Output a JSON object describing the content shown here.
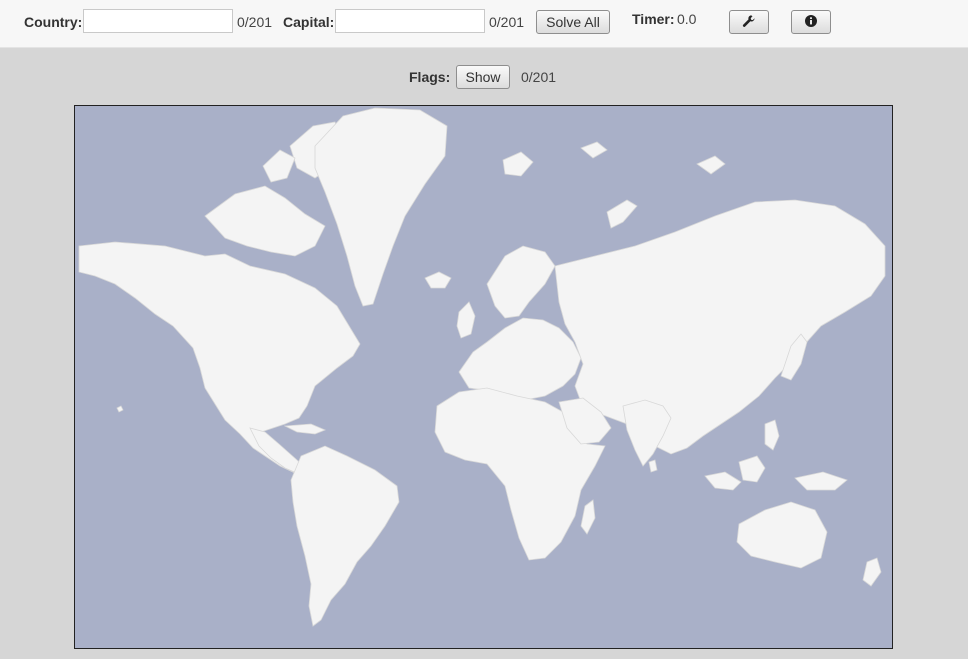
{
  "toolbar": {
    "country_label": "Country:",
    "country_value": "",
    "country_count": "0/201",
    "capital_label": "Capital:",
    "capital_value": "",
    "capital_count": "0/201",
    "solve_all_label": "Solve All",
    "timer_label": "Timer:",
    "timer_value": "0.0",
    "settings_icon": "wrench-icon",
    "info_icon": "info-icon"
  },
  "flags": {
    "label": "Flags:",
    "show_label": "Show",
    "count": "0/201"
  },
  "map": {
    "ocean_color": "#a9b0c8",
    "land_color": "#f4f4f4",
    "border_color": "#d8d8d8"
  }
}
